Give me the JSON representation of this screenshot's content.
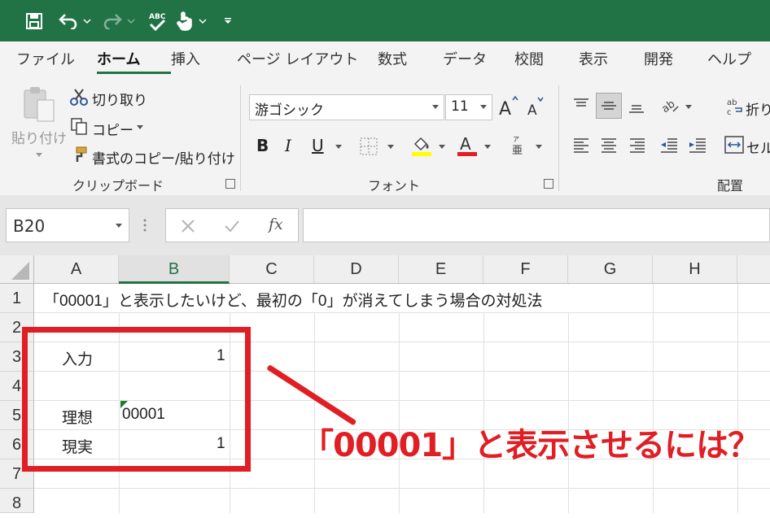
{
  "qat": {
    "icons": [
      "save-icon",
      "undo-icon",
      "redo-icon",
      "spelling-icon",
      "touch-mode-icon",
      "customize-icon"
    ]
  },
  "tabs": [
    "ファイル",
    "ホーム",
    "挿入",
    "ページ レイアウト",
    "数式",
    "データ",
    "校閲",
    "表示",
    "開発",
    "ヘルプ"
  ],
  "active_tab": "ホーム",
  "ribbon": {
    "clipboard": {
      "paste_label": "貼り付け",
      "cut_label": "切り取り",
      "copy_label": "コピー",
      "format_painter_label": "書式のコピー/貼り付け",
      "group_label": "クリップボード"
    },
    "font": {
      "font_name": "游ゴシック",
      "font_size": "11",
      "bold": "B",
      "italic": "I",
      "underline": "U",
      "group_label": "フォント",
      "fill_color": "#ffff00",
      "font_color": "#e01e24"
    },
    "alignment": {
      "wrap_label": "折り",
      "merge_label": "セル",
      "group_label": "配置"
    }
  },
  "formula_bar": {
    "name_box": "B20",
    "fx": "fx",
    "value": ""
  },
  "grid": {
    "columns": [
      "A",
      "B",
      "C",
      "D",
      "E",
      "F",
      "G",
      "H"
    ],
    "selected_column": "B",
    "rows": [
      "1",
      "2",
      "3",
      "4",
      "5",
      "6",
      "7",
      "8"
    ],
    "cells": {
      "A1": "「00001」と表示したいけど、最初の「0」が消えてしまう場合の対処法",
      "A3": "入力",
      "B3": "1",
      "A5": "理想",
      "B5": "00001",
      "A6": "現実",
      "B6": "1"
    }
  },
  "annotation": {
    "callout_text": "「00001」と表示させるには？",
    "color": "#e01e24"
  },
  "colors": {
    "excel_green": "#217346",
    "ribbon_bg": "#f3f3f3"
  }
}
